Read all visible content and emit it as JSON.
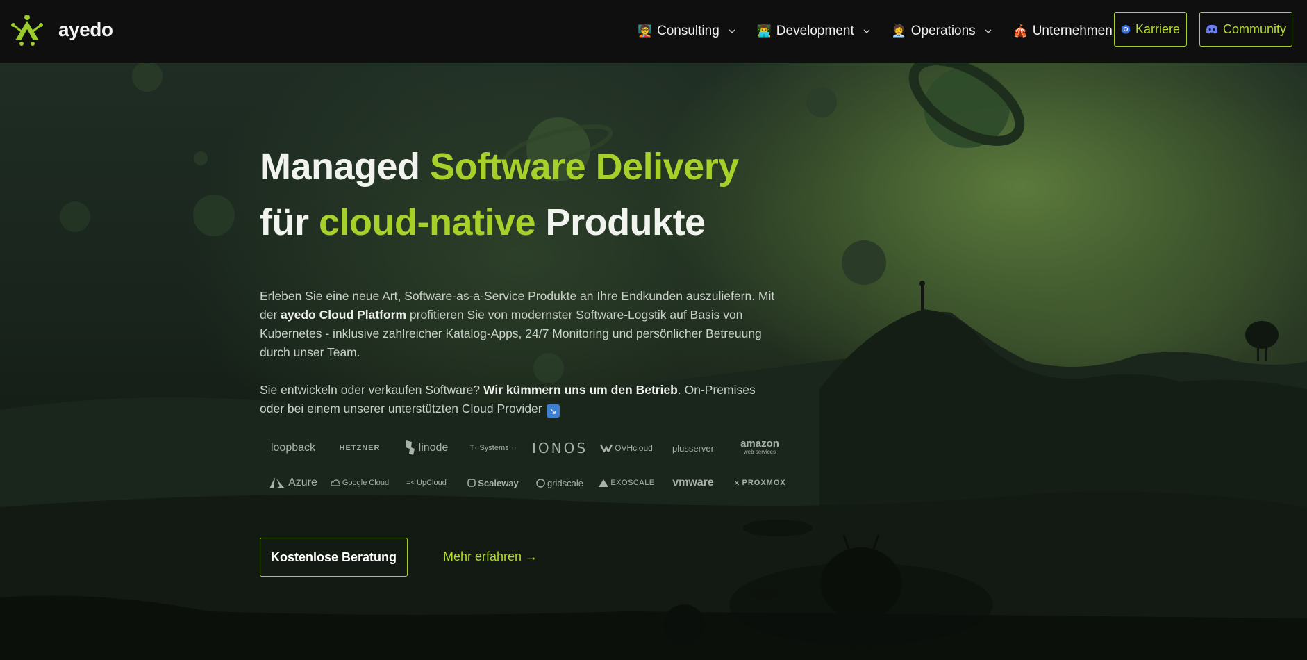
{
  "header": {
    "logo_text": "ayedo",
    "nav": [
      {
        "emoji": "🧑‍🏫",
        "label": "Consulting"
      },
      {
        "emoji": "👨‍💻",
        "label": "Development"
      },
      {
        "emoji": "🧑‍💼",
        "label": "Operations"
      },
      {
        "emoji": "🎪",
        "label": "Unternehmen"
      }
    ],
    "karriere_label": "Karriere",
    "community_label": "Community"
  },
  "hero": {
    "headline_1a": "Managed ",
    "headline_1b": "Software Delivery",
    "headline_2a": "für ",
    "headline_2b": "cloud-native",
    "headline_2c": " Produkte",
    "p1_a": "Erleben Sie eine neue Art, Software-as-a-Service Produkte an Ihre Endkunden auszuliefern. Mit der ",
    "p1_strong": "ayedo Cloud Platform",
    "p1_b": " profitieren Sie von modernster Software-Logstik auf Basis von Kubernetes - inklusive zahlreicher Katalog-Apps, 24/7 Monitoring und persönlicher Betreuung durch unser Team.",
    "p2_a": "Sie entwickeln oder verkaufen Software? ",
    "p2_strong": "Wir kümmern uns um den Betrieb",
    "p2_b": ". On-Premises oder bei einem unserer unterstützten Cloud Provider",
    "p2_arrow": "↘",
    "cta_primary": "Kostenlose Beratung",
    "cta_secondary": "Mehr erfahren →"
  },
  "providers": {
    "loopback": "loopback",
    "hetzner": "HETZNER",
    "linode": "linode",
    "tsystems": "T··Systems···",
    "ionos": "IONOS",
    "ovh": "OVHcloud",
    "plusserver": "plusserver",
    "amazon": "amazon",
    "amazon_sub": "web services",
    "azure": "Azure",
    "google": "Google Cloud",
    "upcloud": "UpCloud",
    "scaleway": "Scaleway",
    "gridscale": "gridscale",
    "exoscale": "EXOSCALE",
    "vmware": "vmware",
    "proxmox": "PROXMOX"
  }
}
